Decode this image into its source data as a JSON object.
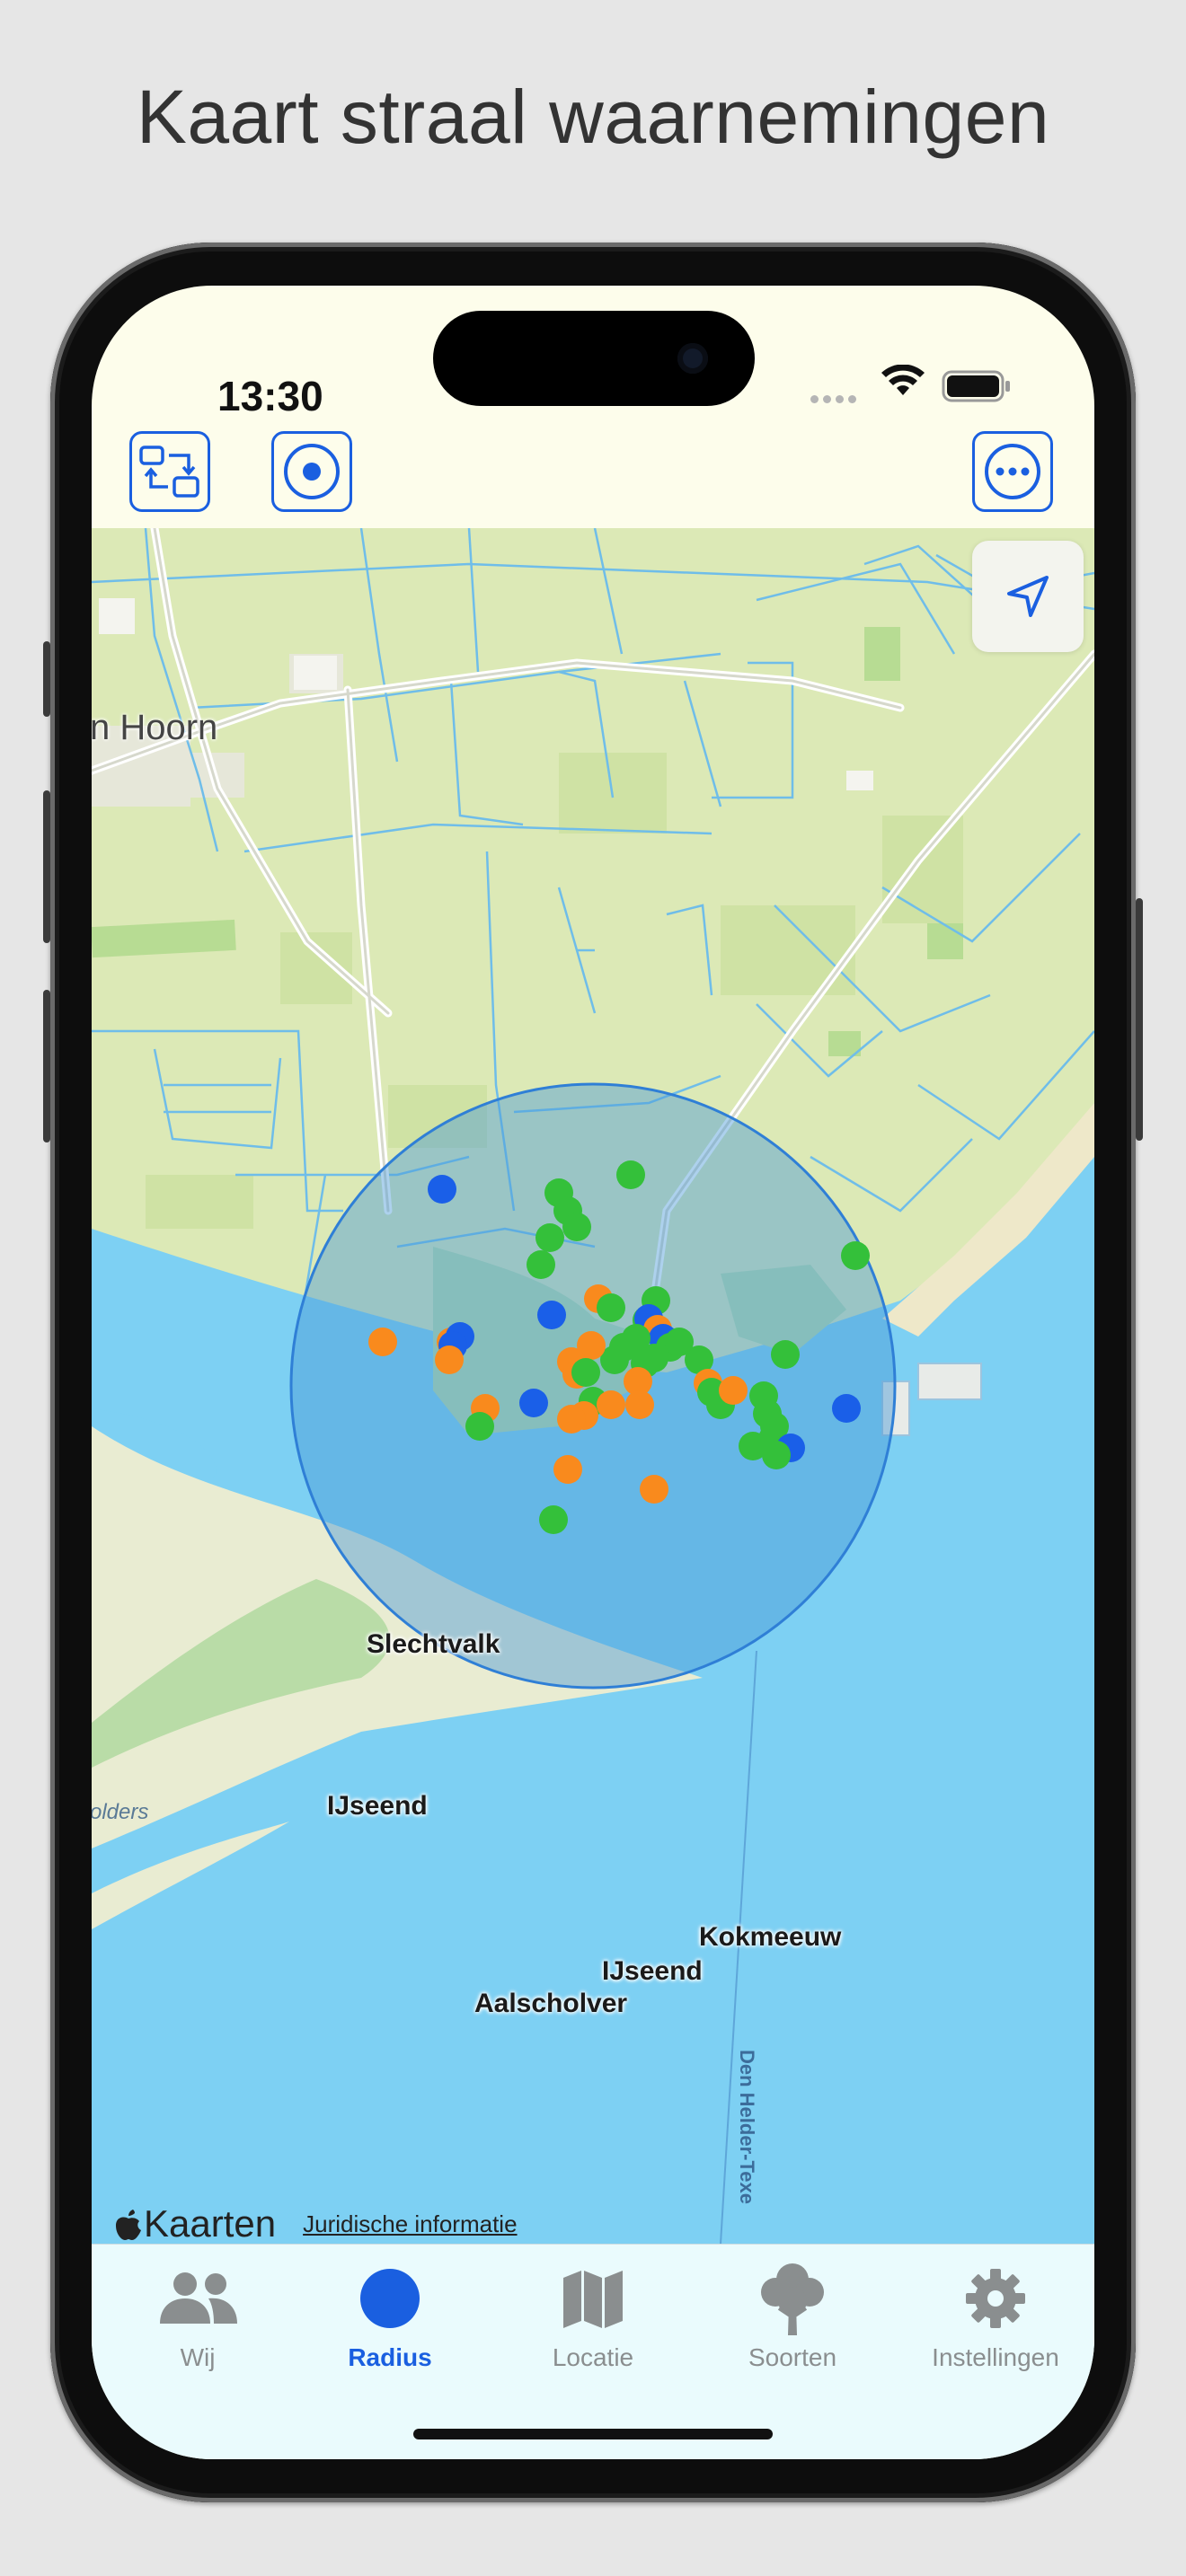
{
  "headline": "Kaart straal waarnemingen",
  "status_bar": {
    "time": "13:30"
  },
  "toolbar": {
    "left_buttons": [
      {
        "icon": "swap-arrows-icon"
      },
      {
        "icon": "target-circle-icon"
      }
    ],
    "right_button": {
      "icon": "ellipsis-circle-icon"
    }
  },
  "map": {
    "place_labels": [
      "n Hoorn",
      "olders"
    ],
    "species_labels": [
      "Slechtvalk",
      "IJseend",
      "Kokmeeuw",
      "IJseend",
      "Aalscholver"
    ],
    "ferry_route_label": "Den Helder-Texe",
    "attribution": {
      "brand": "Kaarten",
      "legal": "Juridische informatie"
    },
    "locate_button_icon": "location-arrow-icon",
    "colors": {
      "radius_circle_fill": "#4a9ad6",
      "observation_green": "#34c03a",
      "observation_orange": "#f98a1d",
      "observation_blue": "#1a5fe8",
      "water": "#7dd0f3",
      "land": "#dce9b6"
    }
  },
  "tabs": [
    {
      "label": "Wij",
      "icon": "people-icon",
      "active": false
    },
    {
      "label": "Radius",
      "icon": "radius-dot-icon",
      "active": true
    },
    {
      "label": "Locatie",
      "icon": "map-icon",
      "active": false
    },
    {
      "label": "Soorten",
      "icon": "tree-icon",
      "active": false
    },
    {
      "label": "Instellingen",
      "icon": "gear-icon",
      "active": false
    }
  ],
  "accent_color": "#1a5fe0"
}
